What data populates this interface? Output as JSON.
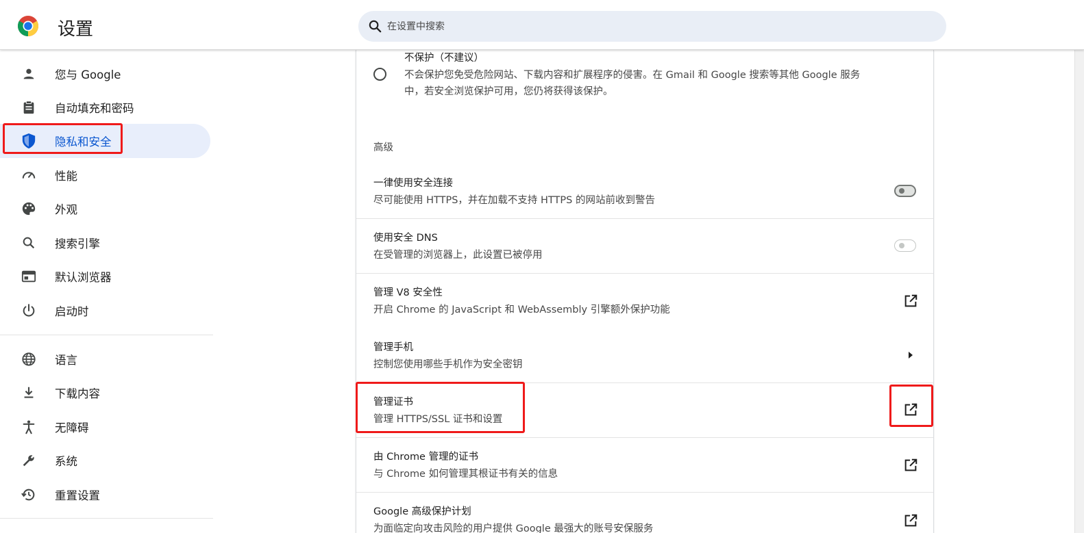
{
  "header": {
    "title": "设置",
    "search": {
      "placeholder": "在设置中搜索"
    }
  },
  "sidebar": {
    "items": [
      {
        "label": "您与 Google",
        "icon": "person-icon"
      },
      {
        "label": "自动填充和密码",
        "icon": "clipboard-icon"
      },
      {
        "label": "隐私和安全",
        "icon": "shield-icon",
        "active": true
      },
      {
        "label": "性能",
        "icon": "speedometer-icon"
      },
      {
        "label": "外观",
        "icon": "palette-icon"
      },
      {
        "label": "搜索引擎",
        "icon": "search-icon"
      },
      {
        "label": "默认浏览器",
        "icon": "browser-window-icon"
      },
      {
        "label": "启动时",
        "icon": "power-icon"
      },
      {
        "label": "语言",
        "icon": "globe-icon"
      },
      {
        "label": "下载内容",
        "icon": "download-icon"
      },
      {
        "label": "无障碍",
        "icon": "accessibility-icon"
      },
      {
        "label": "系统",
        "icon": "wrench-icon"
      },
      {
        "label": "重置设置",
        "icon": "restore-icon"
      }
    ]
  },
  "main": {
    "no_protection": {
      "title": "不保护（不建议）",
      "desc_line1": "不会保护您免受危险网站、下载内容和扩展程序的侵害。在 Gmail 和 Google 搜索等其他 Google 服务",
      "desc_line2": "中，若安全浏览保护可用，您仍将获得该保护。",
      "checked": false
    },
    "advanced_title": "高级",
    "rows": [
      {
        "title": "一律使用安全连接",
        "desc": "尽可能使用 HTTPS，并在加载不支持 HTTPS 的网站前收到警告",
        "control": "toggle",
        "enabled": false
      },
      {
        "title": "使用安全 DNS",
        "desc": "在受管理的浏览器上，此设置已被停用",
        "control": "toggle-disabled",
        "enabled": false
      },
      {
        "title": "管理 V8 安全性",
        "desc": "开启 Chrome 的 JavaScript 和 WebAssembly 引擎额外保护功能",
        "control": "open-in-new-icon"
      },
      {
        "title": "管理手机",
        "desc": "控制您使用哪些手机作为安全密钥",
        "control": "arrow-right-icon"
      },
      {
        "title": "管理证书",
        "desc": "管理 HTTPS/SSL 证书和设置",
        "control": "open-in-new-icon"
      },
      {
        "title": "由 Chrome 管理的证书",
        "desc": "与 Chrome 如何管理其根证书有关的信息",
        "control": "open-in-new-icon"
      },
      {
        "title": "Google 高级保护计划",
        "desc": "为面临定向攻击风险的用户提供 Google 最强大的账号安保服务",
        "control": "open-in-new-icon"
      }
    ]
  },
  "colors": {
    "accent": "#0b57d0",
    "active_bg": "#e8eefb",
    "annotation": "#ef1a1a"
  }
}
